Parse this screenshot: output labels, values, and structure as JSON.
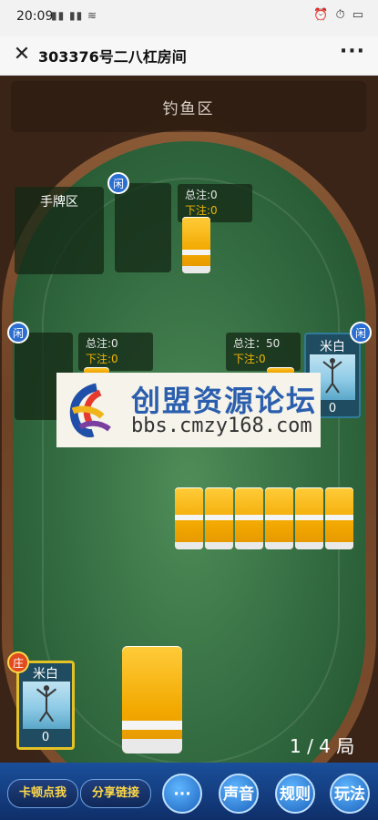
{
  "status": {
    "time": "20:09",
    "left_icons": "▮▮ ▮▮ ≋",
    "right_icons": "⏰ ⏱ ▭"
  },
  "title": {
    "text": "303376号二八杠房间",
    "close": "✕",
    "more": "···"
  },
  "fishing": {
    "label": "钓鱼区"
  },
  "hand_zone": {
    "label": "手牌区"
  },
  "badges": {
    "idle": "闲",
    "dealer": "庄"
  },
  "bets": {
    "top": {
      "total": "总注:0",
      "bet": "下注:0"
    },
    "left": {
      "total": "总注:0",
      "bet": "下注:0"
    },
    "right": {
      "total": "总注：50",
      "bet": "下注:0"
    }
  },
  "players": {
    "right": {
      "name": "米白",
      "score": "0"
    },
    "me": {
      "name": "米白",
      "score": "0"
    }
  },
  "round": {
    "text": "1 / 4 局"
  },
  "watermark": {
    "line1": "创盟资源论坛",
    "line2": "bbs.cmzy168.com"
  },
  "buttons": {
    "lag": "卡顿点我",
    "share": "分享链接",
    "chat": "···",
    "sound": "声音",
    "rules": "规则",
    "play": "玩法"
  }
}
